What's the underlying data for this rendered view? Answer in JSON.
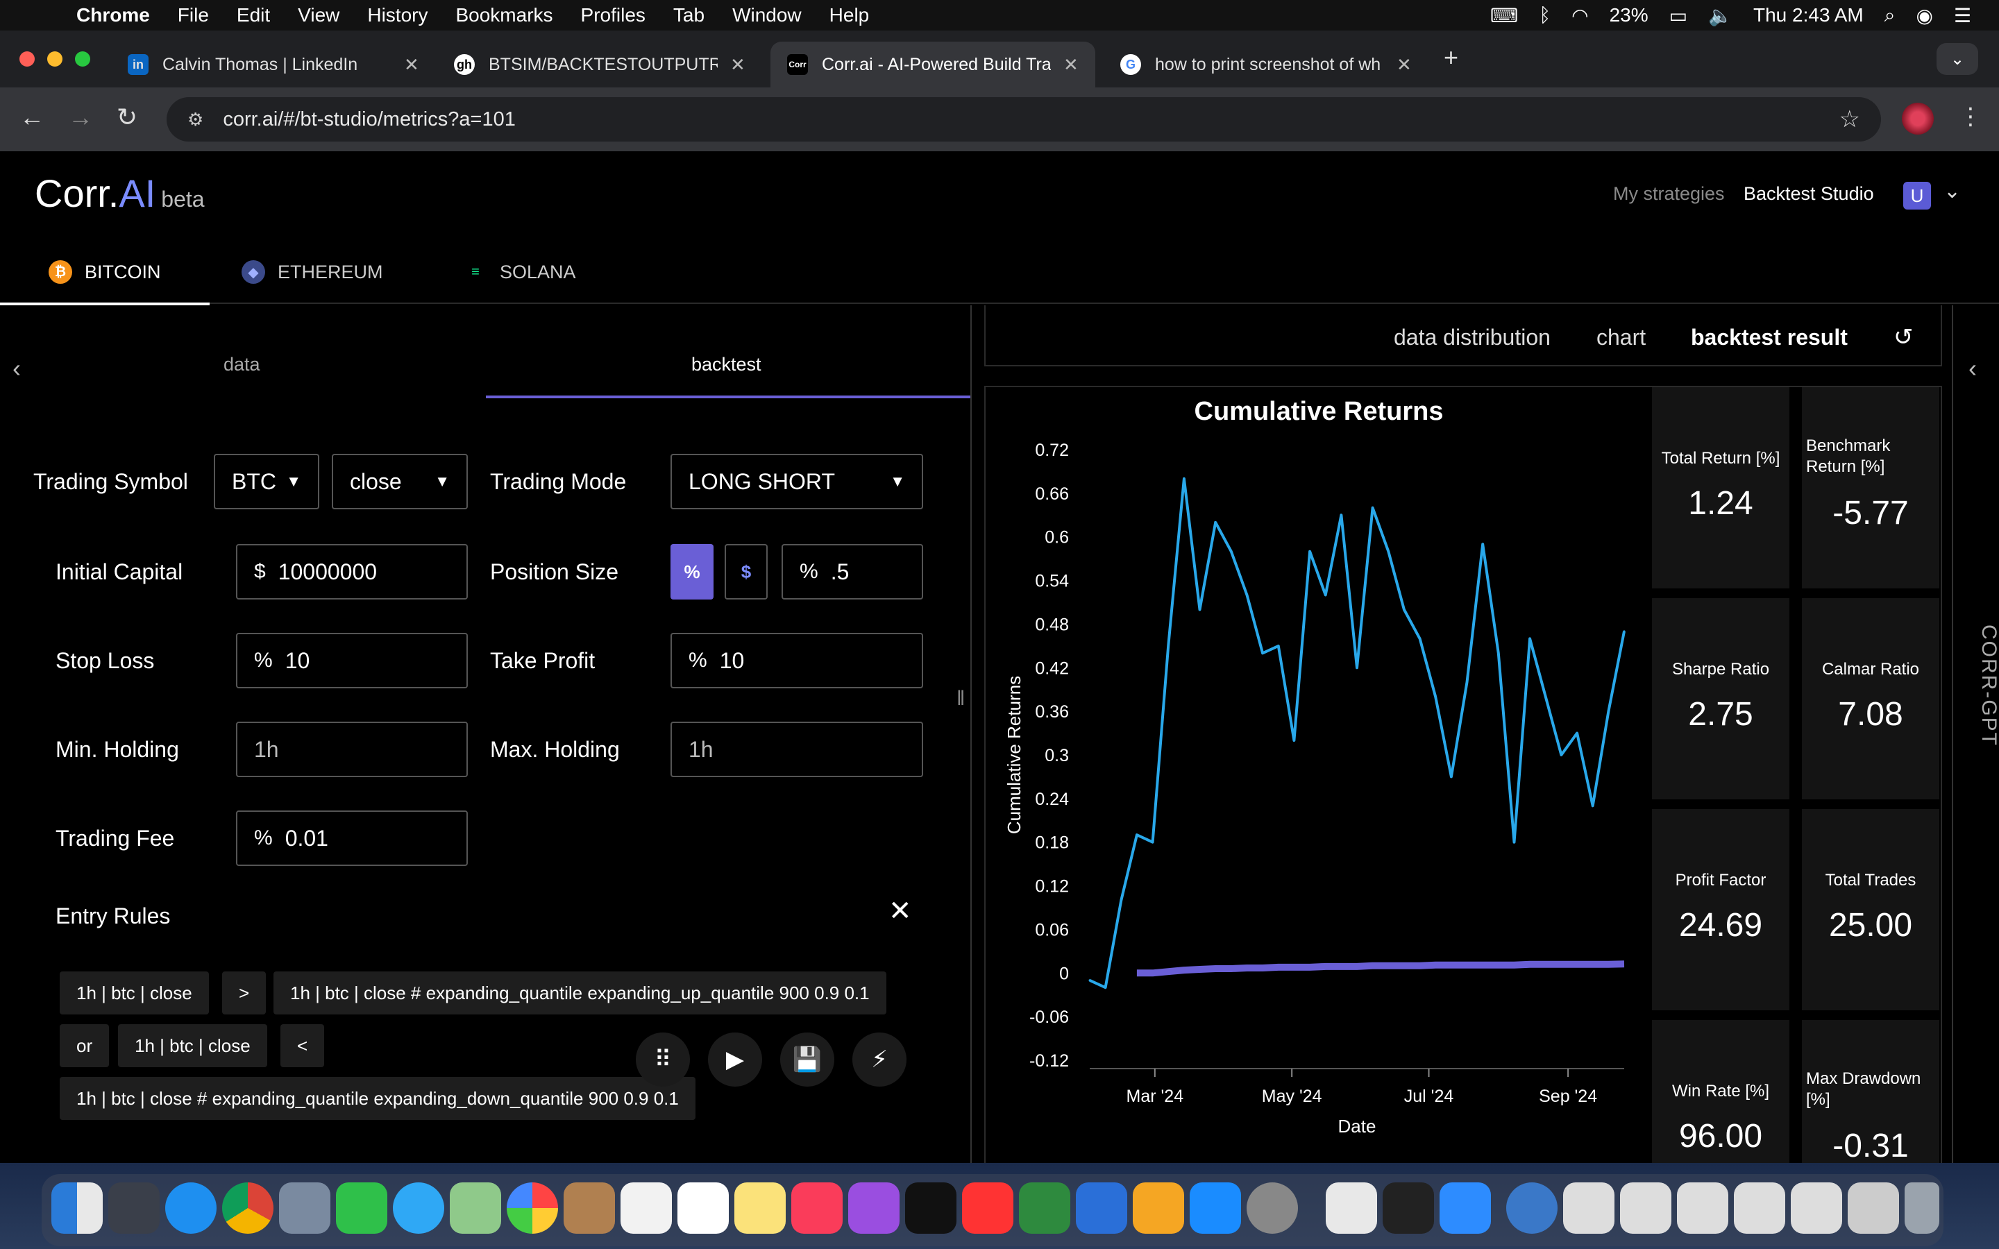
{
  "menubar": {
    "app": "Chrome",
    "items": [
      "File",
      "Edit",
      "View",
      "History",
      "Bookmarks",
      "Profiles",
      "Tab",
      "Window",
      "Help"
    ],
    "battery": "23%",
    "clock": "Thu 2:43 AM"
  },
  "tabs": [
    {
      "title": "Calvin Thomas | LinkedIn",
      "favicon": "in"
    },
    {
      "title": "BTSIM/BACKTESTOUTPUTRE",
      "favicon": "gh"
    },
    {
      "title": "Corr.ai - AI-Powered Build Tra",
      "favicon": "Corr"
    },
    {
      "title": "how to print screenshot of wh",
      "favicon": "G"
    }
  ],
  "address": {
    "url": "corr.ai/#/bt-studio/metrics?a=101"
  },
  "header": {
    "logo_main": "Corr.",
    "logo_ai": "AI",
    "logo_beta": "beta",
    "nav_strategies": "My strategies",
    "nav_studio": "Backtest Studio",
    "user_initial": "U"
  },
  "assets": [
    {
      "label": "BITCOIN",
      "color": "#f7931a",
      "glyph": "₿"
    },
    {
      "label": "ETHEREUM",
      "color": "#627eea",
      "glyph": "◆"
    },
    {
      "label": "SOLANA",
      "color": "#14f195",
      "glyph": "≡"
    }
  ],
  "left": {
    "subtab_data": "data",
    "subtab_backtest": "backtest",
    "trading_symbol_label": "Trading Symbol",
    "symbol_value": "BTC",
    "price_value": "close",
    "trading_mode_label": "Trading Mode",
    "trading_mode_value": "LONG SHORT",
    "initial_capital_label": "Initial Capital",
    "initial_capital_prefix": "$",
    "initial_capital_value": "10000000",
    "position_size_label": "Position Size",
    "pos_pct": "%",
    "pos_usd": "$",
    "position_prefix": "%",
    "position_value": ".5",
    "stop_loss_label": "Stop Loss",
    "stop_loss_prefix": "%",
    "stop_loss_value": "10",
    "take_profit_label": "Take Profit",
    "take_profit_prefix": "%",
    "take_profit_value": "10",
    "min_holding_label": "Min. Holding",
    "min_holding_value": "1h",
    "max_holding_label": "Max. Holding",
    "max_holding_value": "1h",
    "trading_fee_label": "Trading Fee",
    "trading_fee_prefix": "%",
    "trading_fee_value": "0.01",
    "entry_rules_label": "Entry Rules",
    "rule_chips": [
      "1h | btc | close",
      ">",
      "1h | btc | close # expanding_quantile expanding_up_quantile 900 0.9 0.1",
      "or",
      "1h | btc | close",
      "<",
      "1h | btc | close # expanding_quantile expanding_down_quantile 900 0.9 0.1"
    ]
  },
  "right": {
    "tab_distribution": "data distribution",
    "tab_chart": "chart",
    "tab_result": "backtest result",
    "metrics": [
      {
        "label": "Total Return [%]",
        "value": "1.24"
      },
      {
        "label": "Benchmark Return [%]",
        "value": "-5.77"
      },
      {
        "label": "Sharpe Ratio",
        "value": "2.75"
      },
      {
        "label": "Calmar Ratio",
        "value": "7.08"
      },
      {
        "label": "Profit Factor",
        "value": "24.69"
      },
      {
        "label": "Total Trades",
        "value": "25.00"
      },
      {
        "label": "Win Rate [%]",
        "value": "96.00"
      },
      {
        "label": "Max Drawdown [%]",
        "value": "-0.31"
      }
    ],
    "side_label": "CORR-GPT"
  },
  "chart_data": {
    "type": "line",
    "title": "Cumulative Returns",
    "xlabel": "Date",
    "ylabel": "Cumulative Returns",
    "ylim": [
      -0.12,
      0.72
    ],
    "yticks": [
      "0.72",
      "0.66",
      "0.6",
      "0.54",
      "0.48",
      "0.42",
      "0.36",
      "0.3",
      "0.24",
      "0.18",
      "0.12",
      "0.06",
      "0",
      "-0.06",
      "-0.12"
    ],
    "xticks": [
      "Mar '24",
      "May '24",
      "Jul '24",
      "Sep '24"
    ],
    "x": [
      "2024-02-01",
      "2024-02-08",
      "2024-02-15",
      "2024-02-22",
      "2024-02-29",
      "2024-03-07",
      "2024-03-14",
      "2024-03-21",
      "2024-03-28",
      "2024-04-04",
      "2024-04-11",
      "2024-04-18",
      "2024-04-25",
      "2024-05-02",
      "2024-05-09",
      "2024-05-16",
      "2024-05-23",
      "2024-05-30",
      "2024-06-06",
      "2024-06-13",
      "2024-06-20",
      "2024-06-27",
      "2024-07-04",
      "2024-07-11",
      "2024-07-18",
      "2024-07-25",
      "2024-08-01",
      "2024-08-08",
      "2024-08-15",
      "2024-08-22",
      "2024-08-29",
      "2024-09-05",
      "2024-09-12",
      "2024-09-19",
      "2024-09-26"
    ],
    "series": [
      {
        "color": "#29a8ea",
        "values": [
          -0.01,
          -0.02,
          0.1,
          0.19,
          0.18,
          0.45,
          0.68,
          0.5,
          0.62,
          0.58,
          0.52,
          0.44,
          0.45,
          0.32,
          0.58,
          0.52,
          0.63,
          0.42,
          0.64,
          0.58,
          0.5,
          0.46,
          0.38,
          0.27,
          0.4,
          0.59,
          0.44,
          0.18,
          0.46,
          0.38,
          0.3,
          0.33,
          0.23,
          0.36,
          0.47
        ]
      },
      {
        "color": "#6a5fd6",
        "values": [
          null,
          null,
          null,
          0.0,
          0.0,
          0.002,
          0.004,
          0.005,
          0.006,
          0.006,
          0.007,
          0.007,
          0.008,
          0.008,
          0.008,
          0.009,
          0.009,
          0.009,
          0.01,
          0.01,
          0.01,
          0.01,
          0.011,
          0.011,
          0.011,
          0.011,
          0.011,
          0.011,
          0.012,
          0.012,
          0.012,
          0.012,
          0.012,
          0.012,
          0.0124
        ]
      }
    ]
  }
}
